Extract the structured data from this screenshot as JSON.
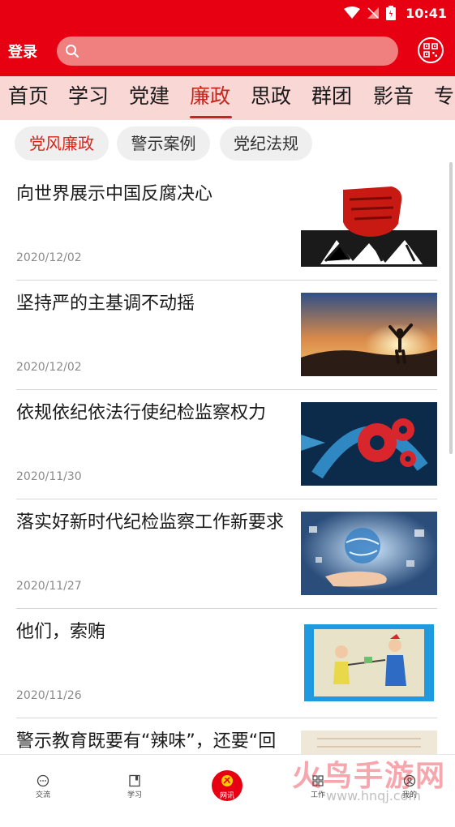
{
  "status_bar": {
    "time": "10:41"
  },
  "header": {
    "login_label": "登录",
    "search_placeholder": "",
    "brand_color": "#e60012"
  },
  "tabs": [
    {
      "label": "首页",
      "active": false
    },
    {
      "label": "学习",
      "active": false
    },
    {
      "label": "党建",
      "active": false
    },
    {
      "label": "廉政",
      "active": true
    },
    {
      "label": "思政",
      "active": false
    },
    {
      "label": "群团",
      "active": false
    },
    {
      "label": "影音",
      "active": false
    },
    {
      "label": "专",
      "active": false
    }
  ],
  "subtabs": [
    {
      "label": "党风廉政",
      "active": true
    },
    {
      "label": "警示案例",
      "active": false
    },
    {
      "label": "党纪法规",
      "active": false
    }
  ],
  "news": [
    {
      "title": "向世界展示中国反腐决心",
      "date": "2020/12/02",
      "thumb": "fist-anti-corruption"
    },
    {
      "title": "坚持严的主基调不动摇",
      "date": "2020/12/02",
      "thumb": "sunset-person"
    },
    {
      "title": "依规依纪依法行使纪检监察权力",
      "date": "2020/11/30",
      "thumb": "gears"
    },
    {
      "title": "落实好新时代纪检监察工作新要求",
      "date": "2020/11/27",
      "thumb": "hand-globe"
    },
    {
      "title": "他们，索贿",
      "date": "2020/11/26",
      "thumb": "cartoon-bribe"
    },
    {
      "title": "警示教育既要有“辣味”，还要“回",
      "date": "",
      "thumb": "meeting-room"
    }
  ],
  "bottom_nav": [
    {
      "label": "交流",
      "icon": "chat-icon"
    },
    {
      "label": "学习",
      "icon": "book-icon"
    },
    {
      "label": "网讯",
      "icon": "party-emblem-icon"
    },
    {
      "label": "工作",
      "icon": "grid-icon"
    },
    {
      "label": "我的",
      "icon": "user-icon"
    }
  ],
  "watermark": {
    "big": "火鸟手游网",
    "small": "www.hnqj.com"
  }
}
